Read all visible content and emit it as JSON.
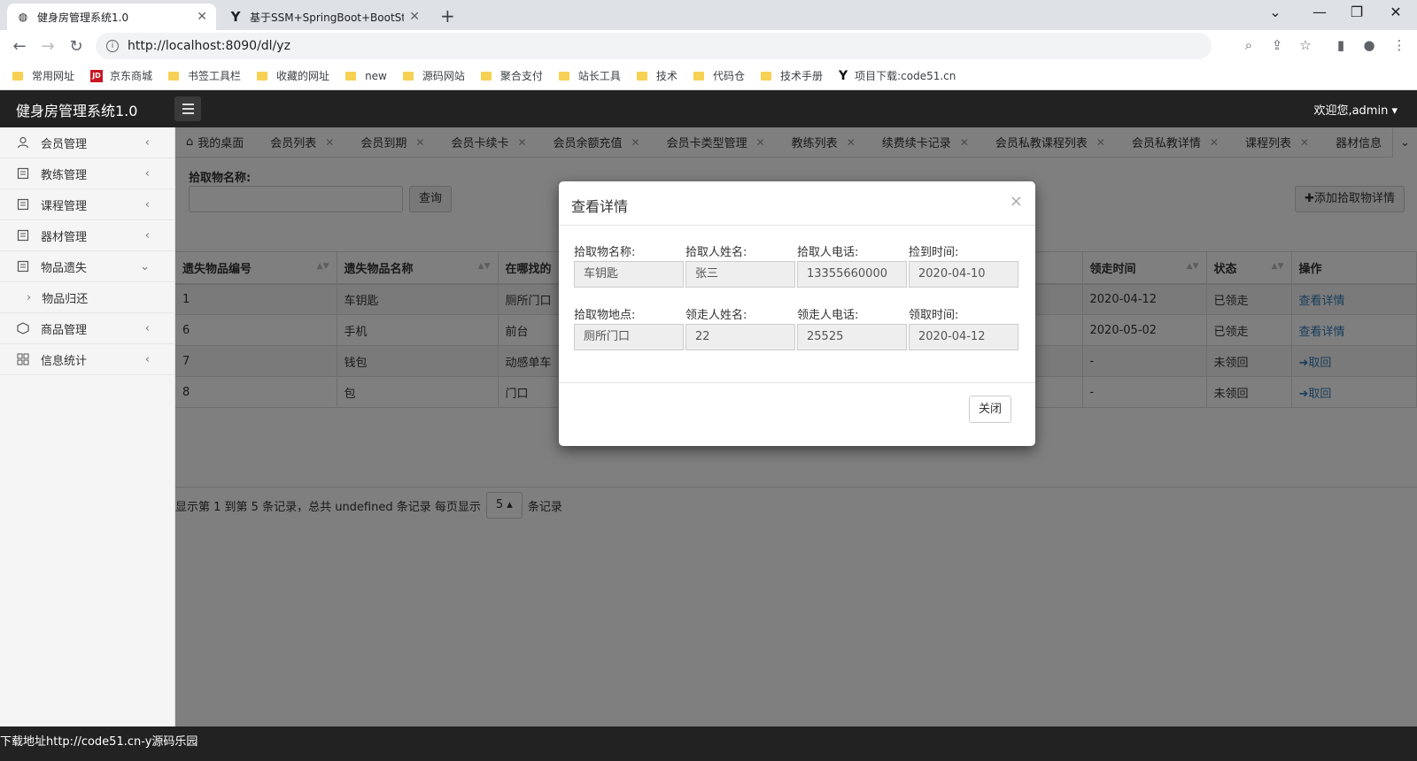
{
  "browser": {
    "tabs": [
      {
        "title": "健身房管理系统1.0",
        "icon": "globe-icon",
        "active": true
      },
      {
        "title": "基于SSM+SpringBoot+BootSt",
        "icon": "y-logo-icon",
        "active": false
      }
    ],
    "url": "http://localhost:8090/dl/yz",
    "bookmarks": [
      {
        "label": "常用网址",
        "icon": "folder-icon"
      },
      {
        "label": "京东商城",
        "icon": "jd-icon"
      },
      {
        "label": "书签工具栏",
        "icon": "folder-icon"
      },
      {
        "label": "收藏的网址",
        "icon": "folder-icon"
      },
      {
        "label": "new",
        "icon": "folder-icon"
      },
      {
        "label": "源码网站",
        "icon": "folder-icon"
      },
      {
        "label": "聚合支付",
        "icon": "folder-icon"
      },
      {
        "label": "站长工具",
        "icon": "folder-icon"
      },
      {
        "label": "技术",
        "icon": "folder-icon"
      },
      {
        "label": "代码仓",
        "icon": "folder-icon"
      },
      {
        "label": "技术手册",
        "icon": "folder-icon"
      },
      {
        "label": "项目下载:code51.cn",
        "icon": "y-logo-icon"
      }
    ]
  },
  "header": {
    "brand": "健身房管理系统1.0",
    "welcome": "欢迎您,admin"
  },
  "sidebar": {
    "items": [
      {
        "label": "会员管理",
        "icon": "user-icon",
        "chevron": "‹"
      },
      {
        "label": "教练管理",
        "icon": "document-icon",
        "chevron": "‹"
      },
      {
        "label": "课程管理",
        "icon": "document-icon",
        "chevron": "‹"
      },
      {
        "label": "器材管理",
        "icon": "document-icon",
        "chevron": "‹"
      },
      {
        "label": "物品遗失",
        "icon": "document-icon",
        "chevron": "⌄"
      }
    ],
    "subitem": "物品归还",
    "items_after": [
      {
        "label": "商品管理",
        "icon": "package-icon",
        "chevron": "‹"
      },
      {
        "label": "信息统计",
        "icon": "grid-icon",
        "chevron": "‹"
      }
    ]
  },
  "content_tabs": [
    "我的桌面",
    "会员列表",
    "会员到期",
    "会员卡续卡",
    "会员余额充值",
    "会员卡类型管理",
    "教练列表",
    "续费续卡记录",
    "会员私教课程列表",
    "会员私教详情",
    "课程列表",
    "器材信息"
  ],
  "search": {
    "label": "拾取物名称:",
    "value": "",
    "query_button": "查询",
    "add_button": "✚添加拾取物详情"
  },
  "table": {
    "columns": [
      "遗失物品编号",
      "遗失物品名称",
      "在哪找的",
      "领走时间",
      "状态",
      "操作"
    ],
    "rows": [
      {
        "id": "1",
        "name": "车钥匙",
        "place": "厕所门口",
        "time": "2020-04-12",
        "status": "已领走",
        "action": "查看详情"
      },
      {
        "id": "6",
        "name": "手机",
        "place": "前台",
        "time": "2020-05-02",
        "status": "已领走",
        "action": "查看详情"
      },
      {
        "id": "7",
        "name": "钱包",
        "place": "动感单车",
        "time": "-",
        "status": "未领回",
        "action": "➜取回"
      },
      {
        "id": "8",
        "name": "包",
        "place": "门口",
        "time": "-",
        "status": "未领回",
        "action": "➜取回"
      }
    ]
  },
  "pager": {
    "prefix": "显示第 1 到第 5 条记录，总共 undefined 条记录 每页显示",
    "page_size": "5 ▴",
    "suffix": "条记录"
  },
  "modal": {
    "title": "查看详情",
    "close_x": "×",
    "row1": [
      {
        "label": "拾取物名称:",
        "value": "车钥匙"
      },
      {
        "label": "拾取人姓名:",
        "value": "张三"
      },
      {
        "label": "拾取人电话:",
        "value": "13355660000"
      },
      {
        "label": "捡到时间:",
        "value": "2020-04-10"
      }
    ],
    "row2": [
      {
        "label": "拾取物地点:",
        "value": "厕所门口"
      },
      {
        "label": "领走人姓名:",
        "value": "22"
      },
      {
        "label": "领走人电话:",
        "value": "25525"
      },
      {
        "label": "领取时间:",
        "value": "2020-04-12"
      }
    ],
    "close_button": "关闭"
  },
  "statusbar": {
    "text": "下载地址http://code51.cn-y源码乐园"
  }
}
